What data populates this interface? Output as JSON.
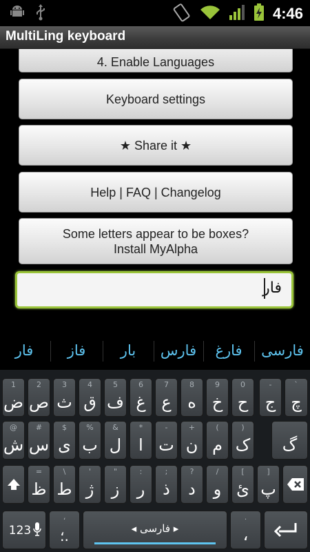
{
  "status_bar": {
    "time": "4:46",
    "icons": [
      "android-debug-icon",
      "usb-icon",
      "rotation-icon",
      "wifi-icon",
      "signal-icon",
      "battery-charging-icon"
    ]
  },
  "app": {
    "title": "MultiLing keyboard"
  },
  "menu": [
    {
      "label": "4. Enable Languages"
    },
    {
      "label": "Keyboard settings"
    },
    {
      "label": "★ Share it ★"
    },
    {
      "label": "Help | FAQ | Changelog"
    },
    {
      "label_line1": "Some letters appear to be boxes?",
      "label_line2": "Install MyAlpha"
    }
  ],
  "input": {
    "value": "فار"
  },
  "candidates": [
    "فار",
    "فاز",
    "بار",
    "فارس",
    "فارغ",
    "فارسی"
  ],
  "keyboard": {
    "row1": [
      {
        "hint": "1",
        "main": "ض"
      },
      {
        "hint": "2",
        "main": "ص"
      },
      {
        "hint": "3",
        "main": "ث"
      },
      {
        "hint": "4",
        "main": "ق"
      },
      {
        "hint": "5",
        "main": "ف"
      },
      {
        "hint": "6",
        "main": "غ"
      },
      {
        "hint": "7",
        "main": "ع"
      },
      {
        "hint": "8",
        "main": "ه"
      },
      {
        "hint": "9",
        "main": "خ"
      },
      {
        "hint": "0",
        "main": "ح"
      },
      {
        "hint": "-",
        "main": "ج"
      },
      {
        "hint": "`",
        "main": "چ"
      }
    ],
    "row2": [
      {
        "hint": "@",
        "main": "ش"
      },
      {
        "hint": "#",
        "main": "س"
      },
      {
        "hint": "$",
        "main": "ی"
      },
      {
        "hint": "%",
        "main": "ب"
      },
      {
        "hint": "&",
        "main": "ل"
      },
      {
        "hint": "*",
        "main": "ا"
      },
      {
        "hint": "-",
        "main": "ت"
      },
      {
        "hint": "+",
        "main": "ن"
      },
      {
        "hint": "(",
        "main": "م"
      },
      {
        "hint": ")",
        "main": "ک"
      },
      {
        "hint": "",
        "main": "گ"
      }
    ],
    "row3": [
      {
        "hint": "=",
        "main": "ظ"
      },
      {
        "hint": "\\",
        "main": "ط"
      },
      {
        "hint": "'",
        "main": "ژ"
      },
      {
        "hint": "\"",
        "main": "ز"
      },
      {
        "hint": ":",
        "main": "ر"
      },
      {
        "hint": ";",
        "main": "ذ"
      },
      {
        "hint": "?",
        "main": "د"
      },
      {
        "hint": "/",
        "main": "و"
      },
      {
        "hint": "[",
        "main": "ئ"
      },
      {
        "hint": "]",
        "main": "پ"
      }
    ],
    "mode_label": "123",
    "punct_key": {
      "hint": "،",
      "main": "؛."
    },
    "space_label": "◂ فارسی ▸",
    "right_key_hint": ".",
    "right_key_main": "،"
  },
  "colors": {
    "accent_green": "#9ac43a",
    "candidate_blue": "#5ec4f0",
    "keyboard_bg": "#1a1d20",
    "space_underline": "#5ec4f0"
  }
}
